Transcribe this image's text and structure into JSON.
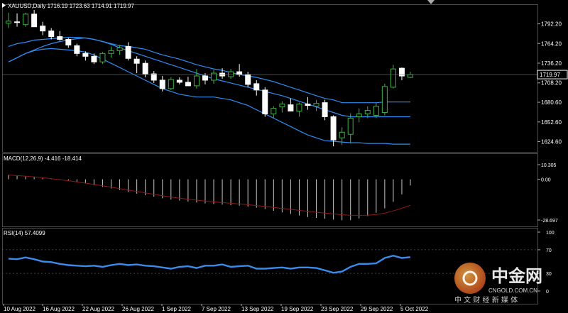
{
  "header": {
    "symbol_line": "XAUUSD,Daily  1716.19 1723.63 1714.91 1719.97"
  },
  "macd_panel": {
    "label": "MACD(12,26,9) -4.416 -18.414",
    "ticks": [
      "10.305",
      "0.00",
      "-28.697"
    ]
  },
  "rsi_panel": {
    "label": "RSI(14) 57.4099",
    "ticks": [
      "100",
      "70",
      "30",
      "0"
    ]
  },
  "watermark": {
    "brand": "中金网",
    "subtitle": "中 文 财 经 新 媒 体",
    "url": "CNGOLD.COM.CN"
  },
  "colors": {
    "background": "#000000",
    "grid": "#4a4a4a",
    "bollinger": "#2f8cf0",
    "candle_up": "#ffffff",
    "candle_down": "#ffffff",
    "candle_up_wick": "#3cb043",
    "macd_hist": "#c8c8c8",
    "macd_signal": "#8b1a1a",
    "rsi_line": "#3b8bea",
    "price_marker": "#ffffff"
  },
  "chart_data": [
    {
      "type": "candlestick",
      "title": "XAUUSD,Daily",
      "ohlc_last": {
        "open": 1716.19,
        "high": 1723.63,
        "low": 1714.91,
        "close": 1719.97
      },
      "ylim": [
        1610,
        1820
      ],
      "y_ticks": [
        1792.2,
        1764.2,
        1736.2,
        1708.2,
        1680.6,
        1652.6,
        1624.6
      ],
      "y_tick_labels": [
        "1792.20",
        "1764.20",
        "1736.20",
        "1708.20",
        "1680.60",
        "1652.60",
        "1624.60"
      ],
      "current_price_label": "1719.97",
      "x_tick_labels": [
        "10 Aug 2022",
        "16 Aug 2022",
        "22 Aug 2022",
        "26 Aug 2022",
        "1 Sep 2022",
        "7 Sep 2022",
        "13 Sep 2022",
        "19 Sep 2022",
        "23 Sep 2022",
        "29 Sep 2022",
        "5 Oct 2022"
      ],
      "candles": [
        {
          "o": 1793,
          "h": 1808,
          "l": 1786,
          "c": 1796
        },
        {
          "o": 1795,
          "h": 1807,
          "l": 1788,
          "c": 1794
        },
        {
          "o": 1791,
          "h": 1808,
          "l": 1788,
          "c": 1806
        },
        {
          "o": 1806,
          "h": 1812,
          "l": 1788,
          "c": 1788
        },
        {
          "o": 1789,
          "h": 1795,
          "l": 1776,
          "c": 1782
        },
        {
          "o": 1782,
          "h": 1786,
          "l": 1770,
          "c": 1774
        },
        {
          "o": 1774,
          "h": 1782,
          "l": 1768,
          "c": 1770
        },
        {
          "o": 1770,
          "h": 1772,
          "l": 1758,
          "c": 1762
        },
        {
          "o": 1761,
          "h": 1764,
          "l": 1746,
          "c": 1750
        },
        {
          "o": 1750,
          "h": 1753,
          "l": 1740,
          "c": 1746
        },
        {
          "o": 1746,
          "h": 1750,
          "l": 1735,
          "c": 1738
        },
        {
          "o": 1738,
          "h": 1752,
          "l": 1735,
          "c": 1750
        },
        {
          "o": 1750,
          "h": 1760,
          "l": 1744,
          "c": 1754
        },
        {
          "o": 1754,
          "h": 1762,
          "l": 1748,
          "c": 1758
        },
        {
          "o": 1760,
          "h": 1766,
          "l": 1740,
          "c": 1743
        },
        {
          "o": 1742,
          "h": 1746,
          "l": 1722,
          "c": 1736
        },
        {
          "o": 1736,
          "h": 1740,
          "l": 1716,
          "c": 1721
        },
        {
          "o": 1721,
          "h": 1725,
          "l": 1708,
          "c": 1712
        },
        {
          "o": 1712,
          "h": 1718,
          "l": 1696,
          "c": 1700
        },
        {
          "o": 1700,
          "h": 1716,
          "l": 1698,
          "c": 1713
        },
        {
          "o": 1712,
          "h": 1716,
          "l": 1706,
          "c": 1709
        },
        {
          "o": 1709,
          "h": 1717,
          "l": 1704,
          "c": 1704
        },
        {
          "o": 1704,
          "h": 1728,
          "l": 1700,
          "c": 1718
        },
        {
          "o": 1718,
          "h": 1722,
          "l": 1706,
          "c": 1712
        },
        {
          "o": 1712,
          "h": 1726,
          "l": 1707,
          "c": 1722
        },
        {
          "o": 1722,
          "h": 1729,
          "l": 1714,
          "c": 1718
        },
        {
          "o": 1717,
          "h": 1728,
          "l": 1714,
          "c": 1724
        },
        {
          "o": 1724,
          "h": 1735,
          "l": 1717,
          "c": 1720
        },
        {
          "o": 1720,
          "h": 1724,
          "l": 1702,
          "c": 1706
        },
        {
          "o": 1707,
          "h": 1712,
          "l": 1690,
          "c": 1698
        },
        {
          "o": 1698,
          "h": 1702,
          "l": 1660,
          "c": 1664
        },
        {
          "o": 1664,
          "h": 1675,
          "l": 1658,
          "c": 1672
        },
        {
          "o": 1674,
          "h": 1682,
          "l": 1666,
          "c": 1678
        },
        {
          "o": 1677,
          "h": 1686,
          "l": 1670,
          "c": 1668
        },
        {
          "o": 1668,
          "h": 1680,
          "l": 1660,
          "c": 1678
        },
        {
          "o": 1678,
          "h": 1688,
          "l": 1670,
          "c": 1676
        },
        {
          "o": 1675,
          "h": 1684,
          "l": 1668,
          "c": 1679
        },
        {
          "o": 1680,
          "h": 1684,
          "l": 1655,
          "c": 1660
        },
        {
          "o": 1660,
          "h": 1662,
          "l": 1618,
          "c": 1627
        },
        {
          "o": 1630,
          "h": 1645,
          "l": 1620,
          "c": 1638
        },
        {
          "o": 1635,
          "h": 1665,
          "l": 1622,
          "c": 1658
        },
        {
          "o": 1660,
          "h": 1672,
          "l": 1652,
          "c": 1664
        },
        {
          "o": 1664,
          "h": 1675,
          "l": 1658,
          "c": 1669
        },
        {
          "o": 1662,
          "h": 1680,
          "l": 1658,
          "c": 1675
        },
        {
          "o": 1666,
          "h": 1707,
          "l": 1662,
          "c": 1703
        },
        {
          "o": 1702,
          "h": 1734,
          "l": 1700,
          "c": 1728
        },
        {
          "o": 1729,
          "h": 1730,
          "l": 1712,
          "c": 1718
        },
        {
          "o": 1716,
          "h": 1724,
          "l": 1715,
          "c": 1720
        }
      ],
      "bollinger": {
        "upper": [
          1738,
          1744,
          1750,
          1755,
          1760,
          1764,
          1767,
          1769,
          1771,
          1772,
          1770,
          1767,
          1764,
          1761,
          1760,
          1758,
          1756,
          1752,
          1748,
          1745,
          1742,
          1738,
          1734,
          1731,
          1728,
          1726,
          1723,
          1720,
          1718,
          1716,
          1713,
          1710,
          1706,
          1702,
          1698,
          1694,
          1690,
          1686,
          1684,
          1680,
          1680,
          1680,
          1680,
          1680,
          1681,
          1681,
          1681,
          1681
        ],
        "middle": [
          1760,
          1764,
          1766,
          1769,
          1770,
          1771,
          1772,
          1773,
          1773,
          1772,
          1770,
          1767,
          1763,
          1758,
          1754,
          1750,
          1746,
          1742,
          1738,
          1734,
          1730,
          1726,
          1722,
          1718,
          1714,
          1711,
          1708,
          1705,
          1702,
          1699,
          1696,
          1693,
          1690,
          1686,
          1682,
          1678,
          1674,
          1670,
          1666,
          1662,
          1660,
          1660,
          1660,
          1660,
          1660,
          1660,
          1660,
          1660
        ],
        "lower": [
          1738,
          1744,
          1750,
          1754,
          1756,
          1757,
          1756,
          1755,
          1754,
          1752,
          1748,
          1742,
          1736,
          1730,
          1724,
          1718,
          1712,
          1706,
          1700,
          1696,
          1692,
          1690,
          1688,
          1688,
          1688,
          1686,
          1684,
          1680,
          1676,
          1670,
          1664,
          1658,
          1652,
          1646,
          1640,
          1634,
          1630,
          1626,
          1625,
          1624,
          1623,
          1623,
          1622,
          1622,
          1622,
          1621,
          1621,
          1621
        ]
      }
    },
    {
      "type": "bar",
      "title": "MACD(12,26,9)",
      "ylim": [
        -28.697,
        10.305
      ],
      "histogram": [
        3.2,
        2.8,
        2.4,
        1.9,
        1.2,
        0.6,
        -0.2,
        -1.1,
        -2.0,
        -3.0,
        -4.2,
        -5.4,
        -6.5,
        -7.6,
        -8.9,
        -10.1,
        -11.2,
        -12.3,
        -13.4,
        -14.3,
        -15.0,
        -15.7,
        -16.4,
        -17.0,
        -17.5,
        -17.9,
        -18.2,
        -18.6,
        -19.2,
        -20.0,
        -21.0,
        -22.2,
        -23.3,
        -24.4,
        -25.5,
        -26.6,
        -27.2,
        -27.8,
        -28.4,
        -28.9,
        -28.8,
        -27.6,
        -25.9,
        -23.6,
        -20.5,
        -15.9,
        -10.6,
        -4.4
      ],
      "signal": [
        3.0,
        2.6,
        2.2,
        1.7,
        1.1,
        0.4,
        -0.3,
        -1.0,
        -1.8,
        -2.7,
        -3.6,
        -4.6,
        -5.6,
        -6.6,
        -7.6,
        -8.6,
        -9.6,
        -10.6,
        -11.6,
        -12.5,
        -13.3,
        -14.0,
        -14.7,
        -15.3,
        -15.9,
        -16.4,
        -16.9,
        -17.4,
        -17.9,
        -18.5,
        -19.1,
        -19.8,
        -20.5,
        -21.2,
        -21.9,
        -22.6,
        -23.2,
        -23.8,
        -24.4,
        -25.0,
        -25.3,
        -25.4,
        -25.3,
        -24.8,
        -23.9,
        -22.3,
        -20.4,
        -18.4
      ],
      "values_label": {
        "macd": -4.416,
        "signal": -18.414
      }
    },
    {
      "type": "line",
      "title": "RSI(14)",
      "ylim": [
        0,
        100
      ],
      "y_ticks": [
        100,
        70,
        30,
        0
      ],
      "values": [
        55,
        54,
        57,
        54,
        50,
        49,
        46,
        44,
        43,
        42,
        43,
        41,
        44,
        46,
        44,
        45,
        43,
        42,
        40,
        38,
        41,
        42,
        39,
        43,
        43,
        45,
        41,
        42,
        43,
        38,
        38,
        39,
        40,
        38,
        40,
        40,
        39,
        35,
        31,
        33,
        41,
        46,
        46,
        47,
        56,
        60,
        56,
        57.4099
      ]
    }
  ]
}
